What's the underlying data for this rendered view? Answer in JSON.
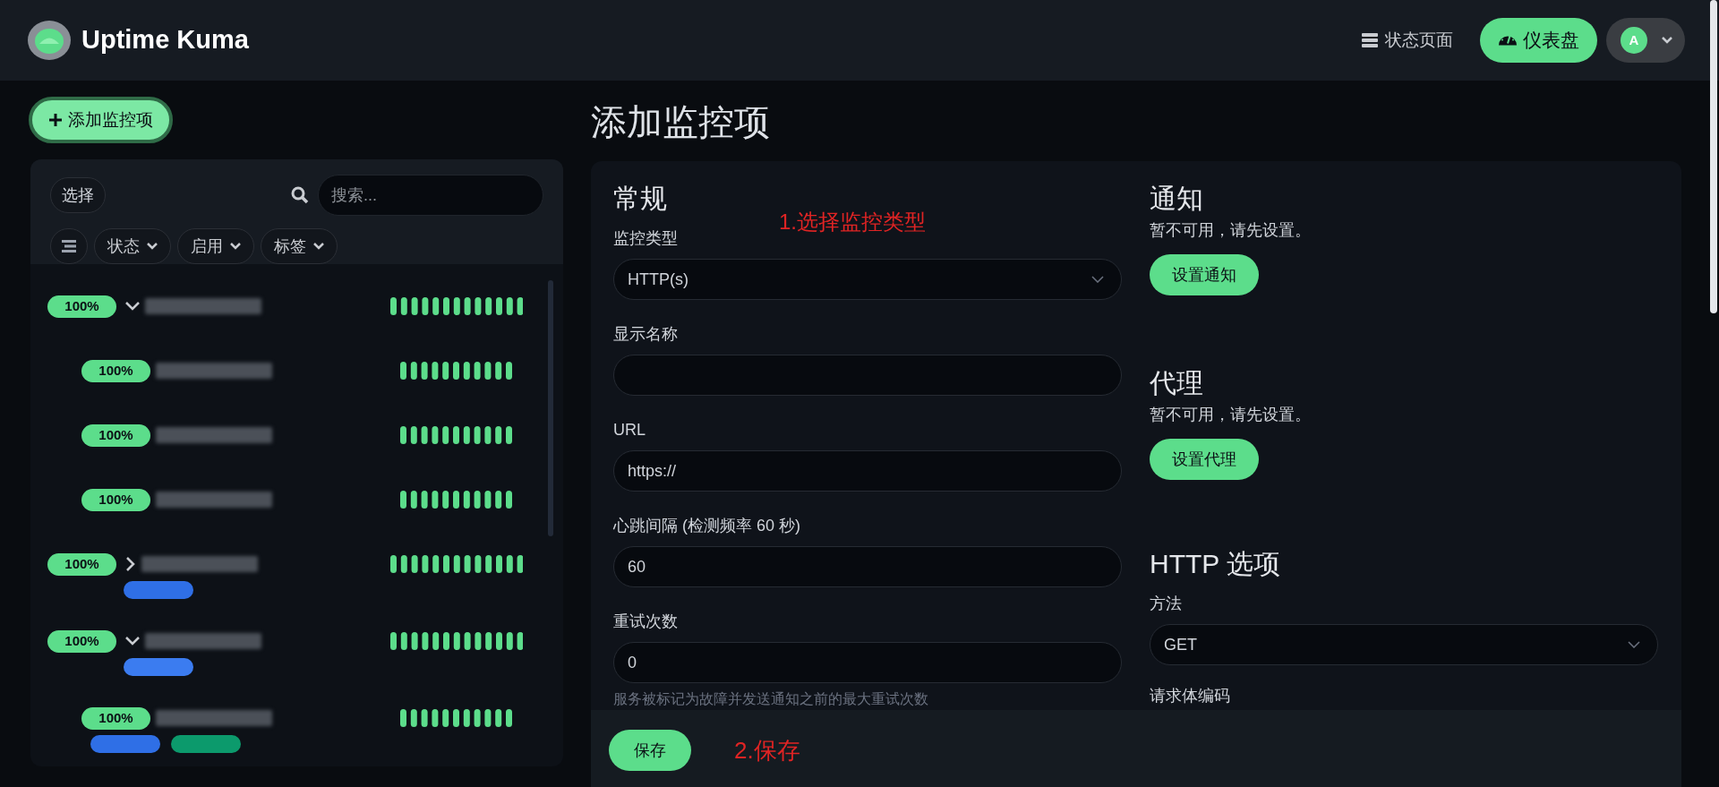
{
  "header": {
    "brand": "Uptime Kuma",
    "status_page": "状态页面",
    "dashboard": "仪表盘",
    "avatar_letter": "A"
  },
  "sidebar": {
    "add_button": "添加监控项",
    "select_button": "选择",
    "search": {
      "placeholder": "搜索..."
    },
    "filters": [
      "状态",
      "启用",
      "标签"
    ],
    "monitors": [
      {
        "uptime": "100%",
        "expanded": true,
        "children": [
          {
            "uptime": "100%"
          },
          {
            "uptime": "100%"
          },
          {
            "uptime": "100%"
          }
        ]
      },
      {
        "uptime": "100%",
        "expanded": false,
        "tags": [
          {
            "color": "#2f6fe6"
          }
        ]
      },
      {
        "uptime": "100%",
        "expanded": true,
        "tags": [
          {
            "color": "#3b7cf0"
          }
        ],
        "children": [
          {
            "uptime": "100%",
            "tags": [
              {
                "color": "#2f6fe6"
              },
              {
                "color": "#0c9a6c"
              }
            ]
          }
        ]
      }
    ]
  },
  "main": {
    "title": "添加监控项",
    "general": {
      "heading": "常规",
      "fields": [
        {
          "kind": "select",
          "label": "监控类型",
          "value": "HTTP(s)"
        },
        {
          "kind": "input",
          "label": "显示名称"
        },
        {
          "kind": "input",
          "label": "URL",
          "value": "https://"
        },
        {
          "kind": "input",
          "label": "心跳间隔 (检测频率 60 秒)",
          "value": "60"
        },
        {
          "kind": "input",
          "label": "重试次数",
          "value": "0",
          "hint": "服务被标记为故障并发送通知之前的最大重试次数"
        }
      ]
    },
    "notification": {
      "heading": "通知",
      "text": "暂不可用，请先设置。",
      "button": "设置通知"
    },
    "proxy": {
      "heading": "代理",
      "text": "暂不可用，请先设置。",
      "button": "设置代理"
    },
    "http_options": {
      "heading": "HTTP 选项",
      "fields": [
        {
          "kind": "select",
          "label": "方法",
          "value": "GET"
        }
      ],
      "next_label": "请求体编码"
    },
    "save_button": "保存",
    "annotations": [
      "1.选择监控类型",
      "2.保存"
    ]
  }
}
